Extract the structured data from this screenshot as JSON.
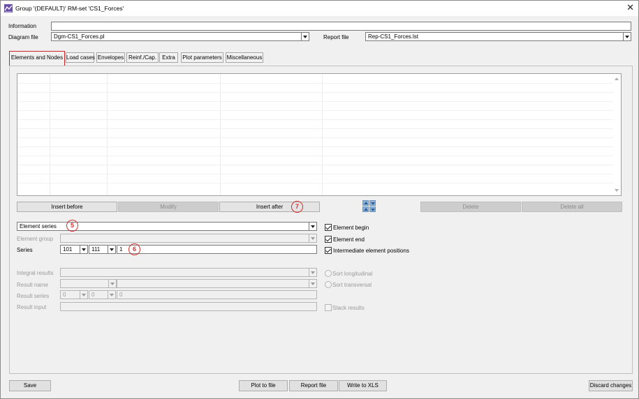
{
  "window": {
    "title": "Group '(DEFAULT)'   RM-set 'CS1_Forces'",
    "close_glyph": "✕"
  },
  "header": {
    "information_label": "Information",
    "information_value": "",
    "diagram_file_label": "Diagram file",
    "diagram_file_value": "Dgm-CS1_Forces.pl",
    "report_file_label": "Report file",
    "report_file_value": "Rep-CS1_Forces.lst"
  },
  "tabs": [
    {
      "label": "Elements and Nodes"
    },
    {
      "label": "Load cases"
    },
    {
      "label": "Envelopes"
    },
    {
      "label": "Reinf./Cap."
    },
    {
      "label": "Extra"
    },
    {
      "label": "Plot parameters"
    },
    {
      "label": "Miscellaneous"
    }
  ],
  "grid_buttons": {
    "insert_before": "Insert before",
    "modify": "Modify",
    "insert_after": "Insert after",
    "delete": "Delete",
    "delete_all": "Delete all"
  },
  "form": {
    "element_series": "Element series",
    "element_group_label": "Element group",
    "series_label": "Series",
    "series_from": "101",
    "series_to": "111",
    "series_step": "1",
    "element_begin": "Element begin",
    "element_end": "Element end",
    "intermediate_positions": "Intermediate element positions",
    "integral_results_label": "Integral results",
    "result_name_label": "Result name",
    "result_series_label": "Result series",
    "result_series_a": "0",
    "result_series_b": "0",
    "result_series_c": "0",
    "result_input_label": "Result input",
    "sort_longitudinal": "Sort longitudinal",
    "sort_transversal": "Sort transversal",
    "stack_results": "Stack results"
  },
  "annotations": {
    "badge_5": "5",
    "badge_6": "6",
    "badge_7": "7"
  },
  "footer": {
    "save": "Save",
    "plot_to_file": "Plot to file",
    "report_file": "Report file",
    "write_to_xls": "Write to XLS",
    "discard_changes": "Discard changes"
  },
  "colors": {
    "annotation_red": "#d03030",
    "active_tab_border": "#d02020"
  }
}
